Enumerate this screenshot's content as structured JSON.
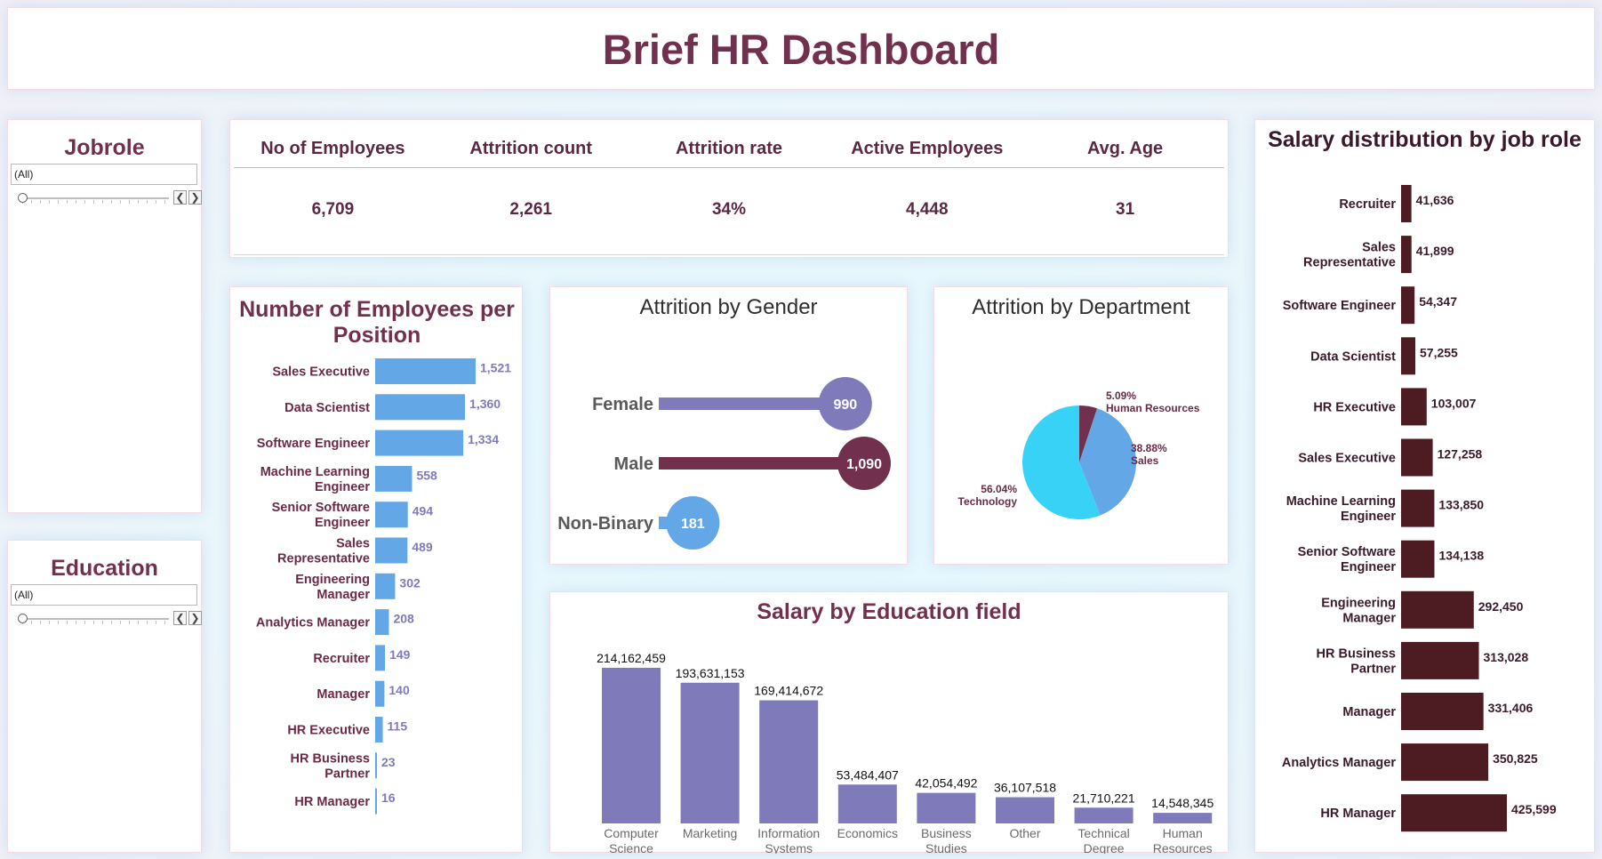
{
  "dashboard_title": "Brief HR Dashboard",
  "filters": {
    "jobrole": {
      "title": "Jobrole",
      "selected": "(All)"
    },
    "education": {
      "title": "Education",
      "selected": "(All)"
    },
    "prev_icon": "❮",
    "next_icon": "❯"
  },
  "kpis": [
    {
      "label": "No of Employees",
      "value": "6,709"
    },
    {
      "label": "Attrition count",
      "value": "2,261"
    },
    {
      "label": "Attrition rate",
      "value": "34%"
    },
    {
      "label": "Active Employees",
      "value": "4,448"
    },
    {
      "label": "Avg. Age",
      "value": "31"
    }
  ],
  "colors": {
    "title": "#72304f",
    "blue_bar": "#63a7e6",
    "purple_bar": "#7f7ab9",
    "maroon": "#72304f",
    "dark_maroon": "#4c1c22",
    "pie_tech": "#39d2f7",
    "pie_sales": "#63a7e6",
    "pie_hr": "#72304f",
    "gender_female": "#7f7ab9",
    "gender_male": "#72304f",
    "gender_nonbinary": "#63a7e6"
  },
  "chart_data": [
    {
      "id": "employees_per_position",
      "type": "bar",
      "orientation": "horizontal",
      "title": "Number of Employees per Position",
      "categories": [
        "Sales Executive",
        "Data Scientist",
        "Software Engineer",
        "Machine Learning Engineer",
        "Senior Software Engineer",
        "Sales Representative",
        "Engineering Manager",
        "Analytics Manager",
        "Recruiter",
        "Manager",
        "HR Executive",
        "HR Business Partner",
        "HR Manager"
      ],
      "values": [
        1521,
        1360,
        1334,
        558,
        494,
        489,
        302,
        208,
        149,
        140,
        115,
        23,
        16
      ],
      "value_labels": [
        "1,521",
        "1,360",
        "1,334",
        "558",
        "494",
        "489",
        "302",
        "208",
        "149",
        "140",
        "115",
        "23",
        "16"
      ]
    },
    {
      "id": "attrition_by_gender",
      "type": "bar",
      "orientation": "horizontal",
      "style": "lollipop",
      "title": "Attrition by Gender",
      "categories": [
        "Female",
        "Male",
        "Non-Binary"
      ],
      "values": [
        990,
        1090,
        181
      ],
      "value_labels": [
        "990",
        "1,090",
        "181"
      ]
    },
    {
      "id": "attrition_by_department",
      "type": "pie",
      "title": "Attrition by Department",
      "slices": [
        {
          "label": "Technology",
          "percent": 56.04,
          "pct_label": "56.04%"
        },
        {
          "label": "Sales",
          "percent": 38.88,
          "pct_label": "38.88%"
        },
        {
          "label": "Human Resources",
          "percent": 5.09,
          "pct_label": "5.09%"
        }
      ]
    },
    {
      "id": "salary_by_education_field",
      "type": "bar",
      "title": "Salary by Education field",
      "categories": [
        "Computer Science",
        "Marketing",
        "Information Systems",
        "Economics",
        "Business Studies",
        "Other",
        "Technical Degree",
        "Human Resources"
      ],
      "values": [
        214162459,
        193631153,
        169414672,
        53484407,
        42054492,
        36107518,
        21710221,
        14548345
      ],
      "value_labels": [
        "214,162,459",
        "193,631,153",
        "169,414,672",
        "53,484,407",
        "42,054,492",
        "36,107,518",
        "21,710,221",
        "14,548,345"
      ]
    },
    {
      "id": "salary_distribution_by_job_role",
      "type": "bar",
      "orientation": "horizontal",
      "title": "Salary distribution by job role",
      "categories": [
        "Recruiter",
        "Sales Representative",
        "Software Engineer",
        "Data Scientist",
        "HR Executive",
        "Sales Executive",
        "Machine Learning Engineer",
        "Senior Software Engineer",
        "Engineering Manager",
        "HR Business Partner",
        "Manager",
        "Analytics Manager",
        "HR Manager"
      ],
      "values": [
        41636,
        41899,
        54347,
        57255,
        103007,
        127258,
        133850,
        134138,
        292450,
        313028,
        331406,
        350825,
        425599
      ],
      "value_labels": [
        "41,636",
        "41,899",
        "54,347",
        "57,255",
        "103,007",
        "127,258",
        "133,850",
        "134,138",
        "292,450",
        "313,028",
        "331,406",
        "350,825",
        "425,599"
      ]
    }
  ]
}
